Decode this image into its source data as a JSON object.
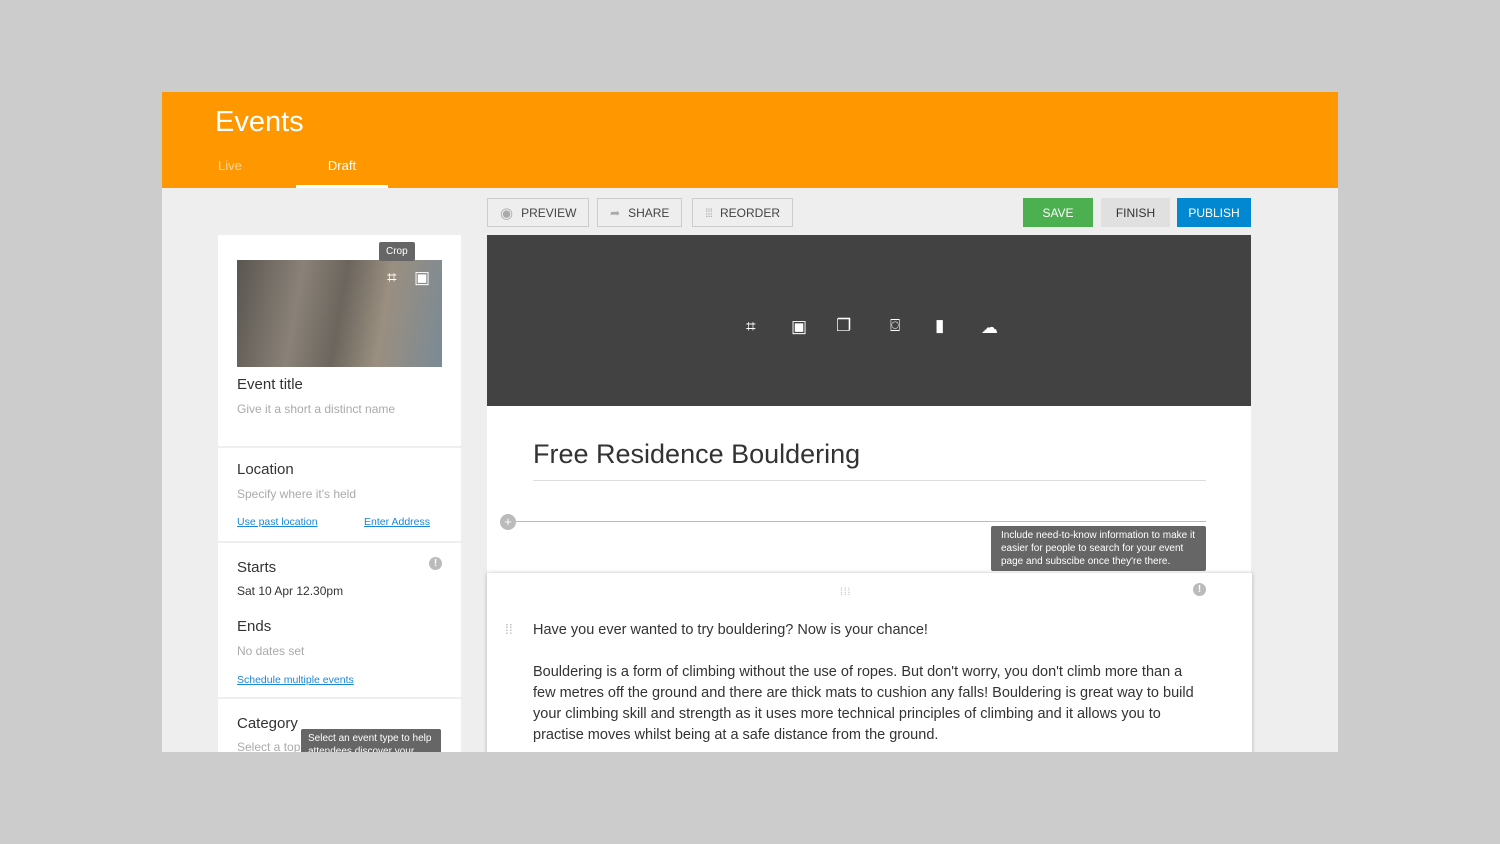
{
  "header": {
    "title": "Events",
    "tabs": [
      {
        "label": "Live"
      },
      {
        "label": "Draft"
      }
    ]
  },
  "toolbar": {
    "preview": "PREVIEW",
    "share": "SHARE",
    "reorder": "REORDER",
    "save": "SAVE",
    "finish": "FINISH",
    "publish": "PUBLISH"
  },
  "colors": {
    "brand": "#ff9800",
    "save": "#4caf50",
    "publish": "#0288d1"
  },
  "sidebar": {
    "crop_tooltip": "Crop",
    "event_title": {
      "label": "Event title",
      "hint": "Give it a short a distinct name"
    },
    "location": {
      "label": "Location",
      "hint": "Specify where it's held",
      "link1": "Use past location",
      "link2": "Enter Address"
    },
    "starts": {
      "label": "Starts",
      "value": "Sat 10 Apr 12.30pm"
    },
    "ends": {
      "label": "Ends",
      "hint": "No dates set",
      "link": "Schedule multiple events"
    },
    "category": {
      "label": "Category",
      "hint": "Select a topic",
      "tooltip": "Select an event type to help attendees discover your"
    }
  },
  "editor": {
    "title": "Free Residence Bouldering",
    "tooltip": "Include need-to-know information to make it easier for people to search for your event page and subscibe once they're there.",
    "p1": "Have you ever wanted to try bouldering? Now is your chance!",
    "p2": "Bouldering is a form of climbing without the use of ropes. But don't worry, you don't climb more than a few metres off the ground and there are thick mats to cushion any falls! Bouldering is great way to build your climbing skill and strength as it uses more technical principles of climbing and it allows you to practise moves whilst being at a safe distance from the ground."
  }
}
